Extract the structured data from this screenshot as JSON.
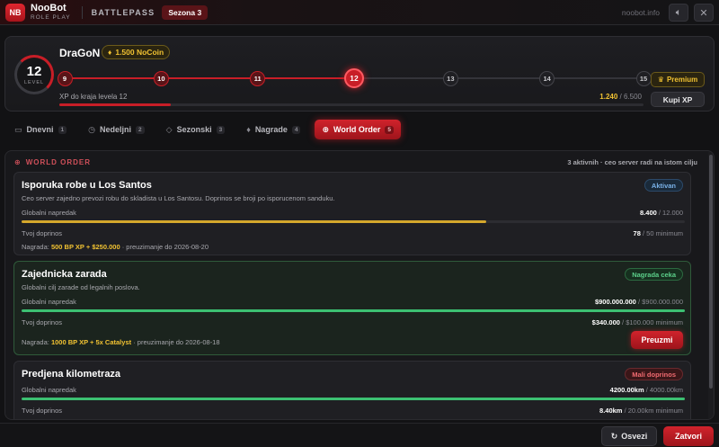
{
  "app": {
    "logo": "NB",
    "name": "NooBot",
    "sub": "ROLE PLAY",
    "section": "BATTLEPASS",
    "season": "Sezona 3",
    "site": "noobot.info"
  },
  "icons": {
    "sound": "speaker-icon",
    "close": "close-icon",
    "coin": "diamond-icon",
    "premium": "crown-icon",
    "refresh": "refresh-icon"
  },
  "colors": {
    "accent": "#c81e27",
    "gold": "#f1c232",
    "green": "#3cc072"
  },
  "profile": {
    "level": "12",
    "level_label": "LEVEL",
    "username": "DraGoN",
    "coins": "1.500 NoCoin",
    "xp_label": "XP do kraja levela 12",
    "xp_current": "1.240",
    "xp_total": "/ 6.500",
    "xp_progress": 0.19,
    "premium": "Premium",
    "buy_xp": "Kupi XP",
    "milestones": [
      {
        "label": "9",
        "state": "done"
      },
      {
        "label": "10",
        "state": "done"
      },
      {
        "label": "11",
        "state": "done"
      },
      {
        "label": "12",
        "state": "current"
      },
      {
        "label": "13",
        "state": "locked"
      },
      {
        "label": "14",
        "state": "locked"
      },
      {
        "label": "15",
        "state": "locked"
      }
    ]
  },
  "tabs": [
    {
      "label": "Dnevni",
      "count": "1",
      "icon": "calendar-icon",
      "glyph": "▭"
    },
    {
      "label": "Nedeljni",
      "count": "2",
      "icon": "clock-icon",
      "glyph": "◷"
    },
    {
      "label": "Sezonski",
      "count": "3",
      "icon": "layers-icon",
      "glyph": "◇"
    },
    {
      "label": "Nagrade",
      "count": "4",
      "icon": "gem-icon",
      "glyph": "♦"
    },
    {
      "label": "World Order",
      "count": "5",
      "icon": "globe-icon",
      "glyph": "⊕",
      "active": true
    }
  ],
  "world_order": {
    "heading": "WORLD ORDER",
    "note": "3 aktivnih · ceo server radi na istom cilju",
    "orders": [
      {
        "title": "Isporuka robe u Los Santos",
        "desc": "Ceo server zajedno prevozi robu do skladista u Los Santosu. Doprinos se broji po isporucenom sanduku.",
        "badge": "Aktivan",
        "badge_style": "blue",
        "global_label": "Globalni napredak",
        "global_value": "8.400",
        "global_total": "/ 12.000",
        "global_progress": 0.7,
        "global_color": "#d4a72c",
        "contrib_label": "Tvoj doprinos",
        "contrib_value": "78",
        "contrib_total": "/ 50 minimum",
        "reward_prefix": "Nagrada:",
        "reward": "500 BP XP + $250.000",
        "reward_suffix": "· preuzimanje do 2026-08-20"
      },
      {
        "title": "Zajednicka zarada",
        "desc": "Globalni cilj zarade od legalnih poslova.",
        "badge": "Nagrada ceka",
        "badge_style": "green",
        "global_label": "Globalni napredak",
        "global_value": "$900.000.000",
        "global_total": "/ $900.000.000",
        "global_progress": 1.0,
        "global_color": "#3cc072",
        "contrib_label": "Tvoj doprinos",
        "contrib_value": "$340.000",
        "contrib_total": "/ $100.000 minimum",
        "reward_prefix": "Nagrada:",
        "reward": "1000 BP XP + 5x Catalyst",
        "reward_suffix": "· preuzimanje do 2026-08-18",
        "claim": "Preuzmi"
      },
      {
        "title": "Predjena kilometraza",
        "badge": "Mali doprinos",
        "badge_style": "red",
        "global_label": "Globalni napredak",
        "global_value": "4200.00km",
        "global_total": "/ 4000.00km",
        "global_progress": 1.0,
        "global_color": "#3cc072",
        "contrib_label": "Tvoj doprinos",
        "contrib_value": "8.40km",
        "contrib_total": "/ 20.00km minimum"
      }
    ]
  },
  "footer": {
    "refresh": "Osvezi",
    "close": "Zatvori"
  }
}
